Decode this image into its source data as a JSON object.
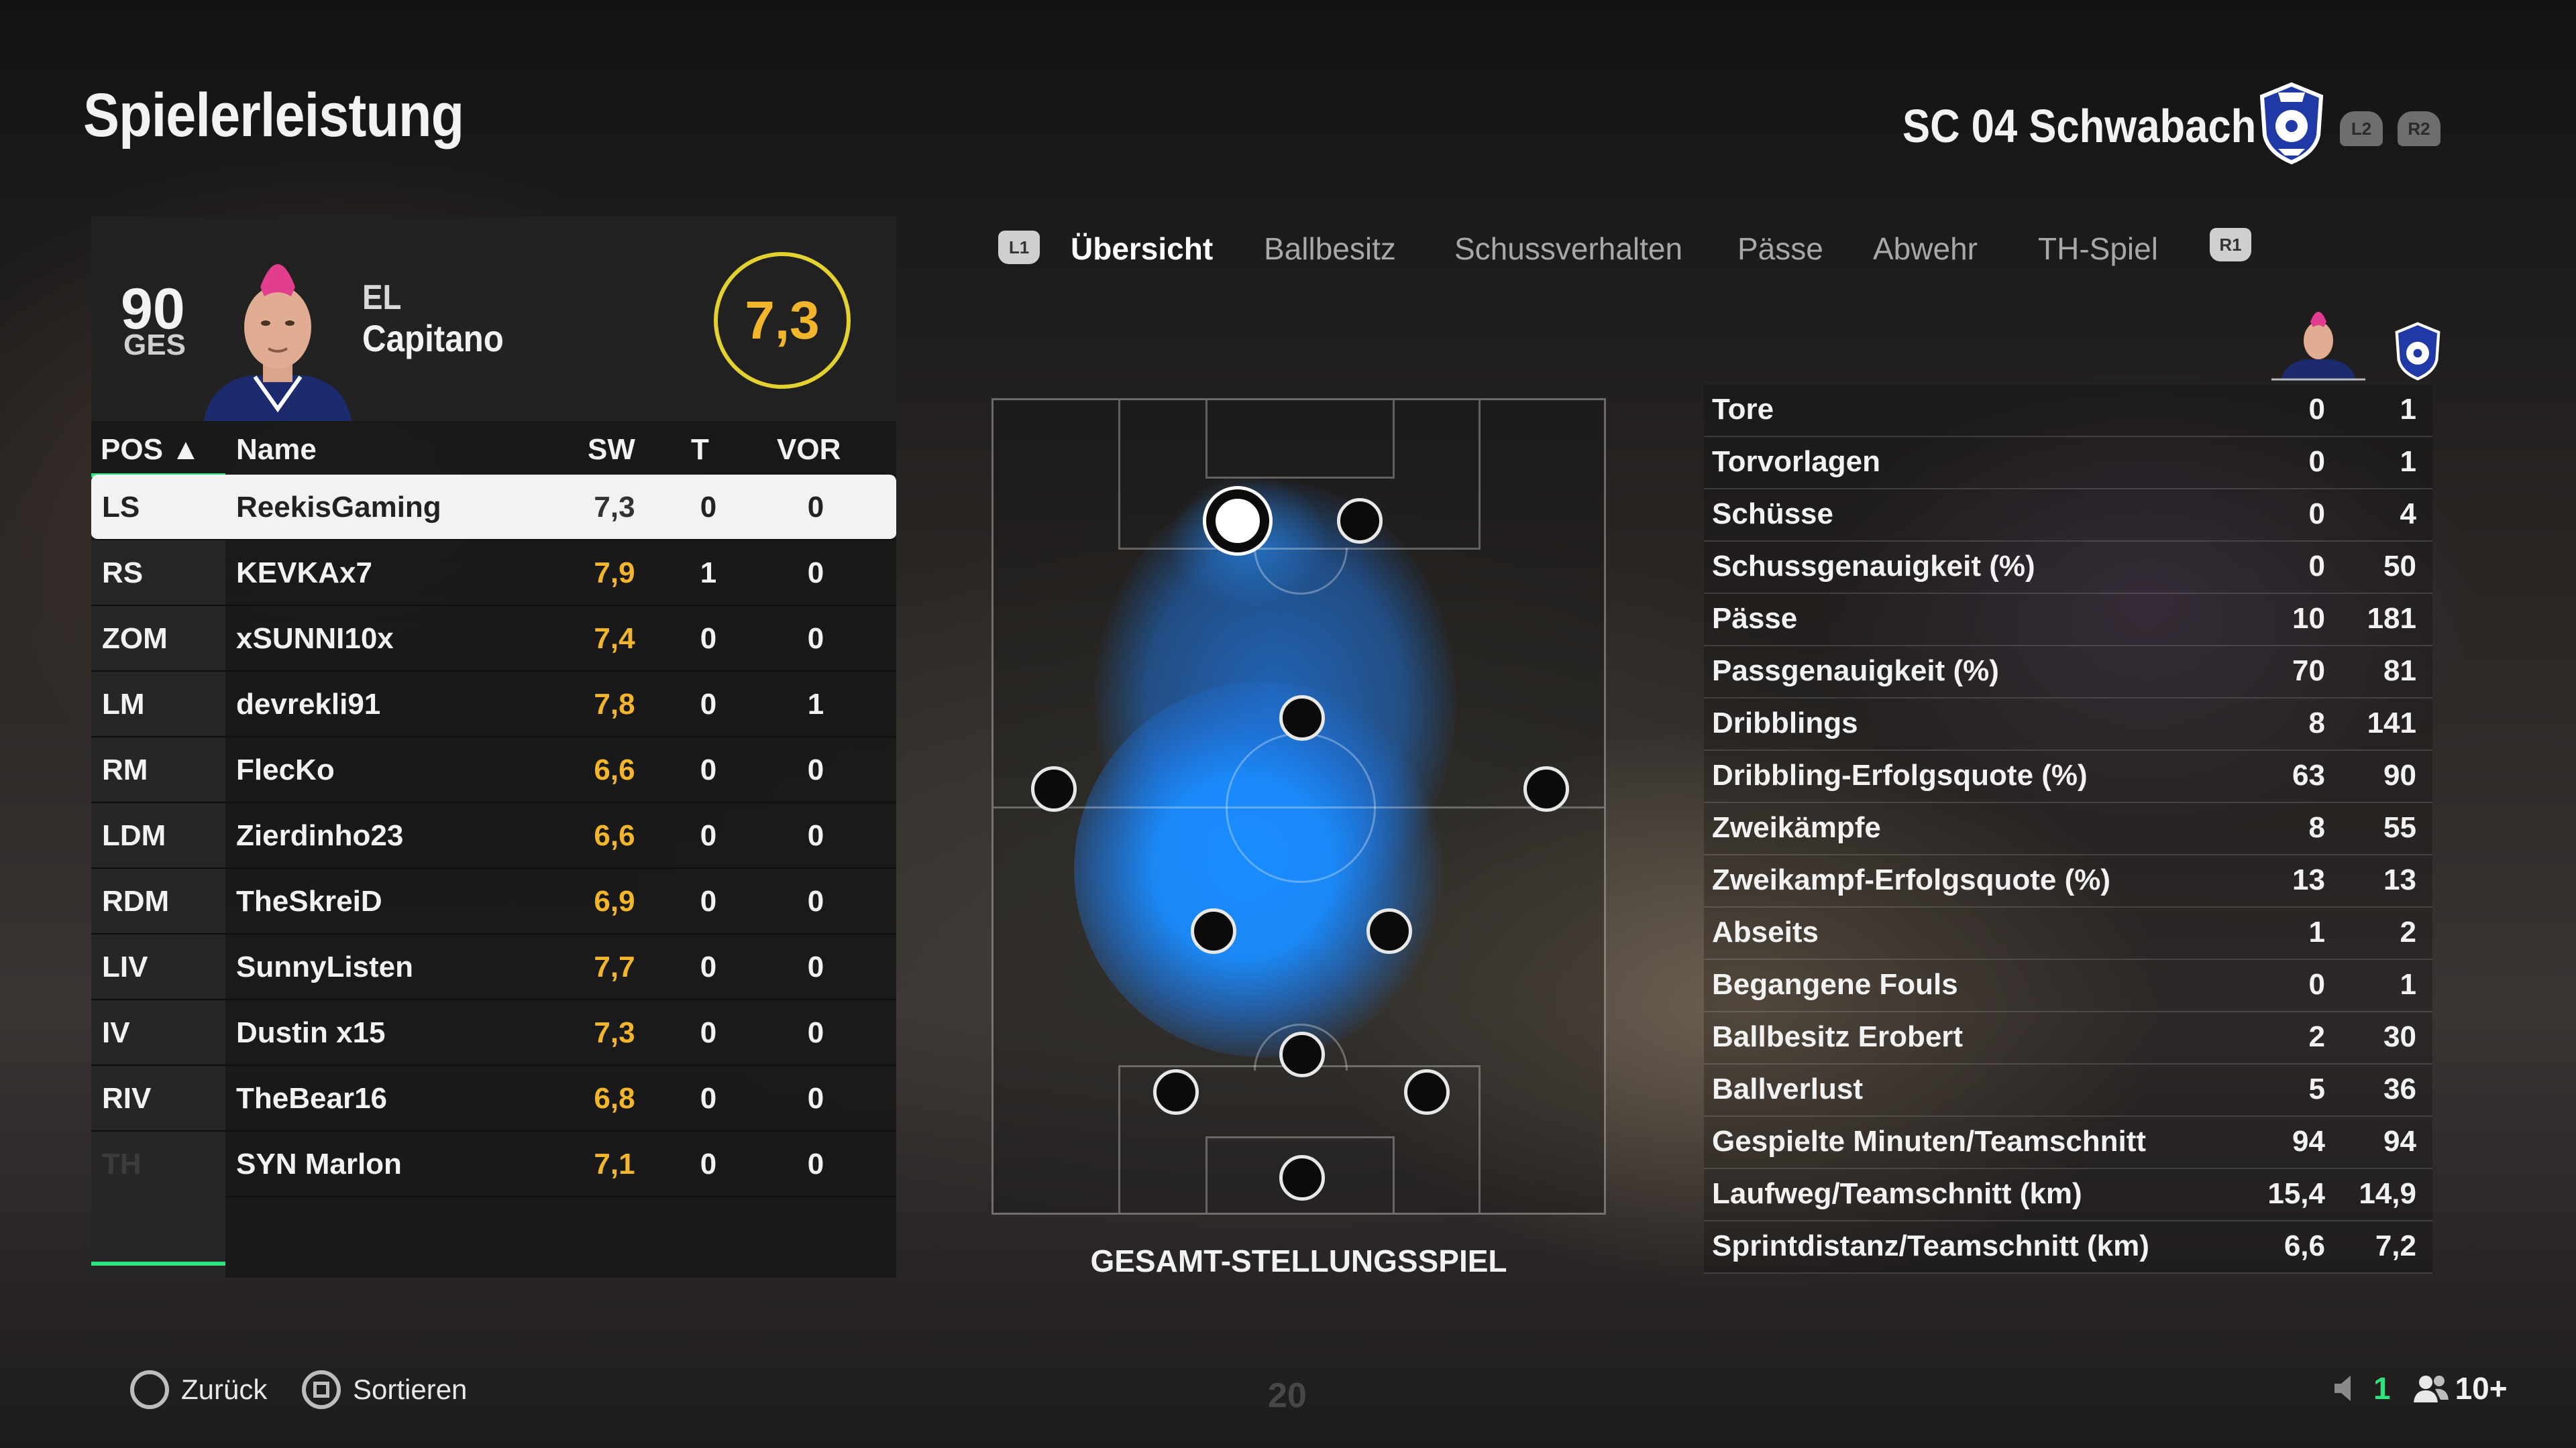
{
  "header": {
    "title": "Spielerleistung",
    "club_name": "SC 04 Schwabach",
    "l2_label": "L2",
    "r2_label": "R2"
  },
  "player_card": {
    "overall": "90",
    "overall_label": "GES",
    "nick_line1": "EL",
    "nick_line2": "Capitano",
    "rating": "7,3"
  },
  "table": {
    "headers": {
      "pos": "POS ▲",
      "name": "Name",
      "sw": "SW",
      "t": "T",
      "vor": "VOR"
    },
    "rows": [
      {
        "pos": "LS",
        "name": "ReekisGaming",
        "sw": "7,3",
        "t": "0",
        "vor": "0"
      },
      {
        "pos": "RS",
        "name": "KEVKAx7",
        "sw": "7,9",
        "t": "1",
        "vor": "0"
      },
      {
        "pos": "ZOM",
        "name": "xSUNNI10x",
        "sw": "7,4",
        "t": "0",
        "vor": "0"
      },
      {
        "pos": "LM",
        "name": "devrekli91",
        "sw": "7,8",
        "t": "0",
        "vor": "1"
      },
      {
        "pos": "RM",
        "name": "FlecKo",
        "sw": "6,6",
        "t": "0",
        "vor": "0"
      },
      {
        "pos": "LDM",
        "name": "Zierdinho23",
        "sw": "6,6",
        "t": "0",
        "vor": "0"
      },
      {
        "pos": "RDM",
        "name": "TheSkreiD",
        "sw": "6,9",
        "t": "0",
        "vor": "0"
      },
      {
        "pos": "LIV",
        "name": "SunnyListen",
        "sw": "7,7",
        "t": "0",
        "vor": "0"
      },
      {
        "pos": "IV",
        "name": "Dustin x15",
        "sw": "7,3",
        "t": "0",
        "vor": "0"
      },
      {
        "pos": "RIV",
        "name": "TheBear16",
        "sw": "6,8",
        "t": "0",
        "vor": "0"
      },
      {
        "pos": "TH",
        "name": "SYN Marlon",
        "sw": "7,1",
        "t": "0",
        "vor": "0"
      }
    ]
  },
  "tabs": {
    "l1_label": "L1",
    "r1_label": "R1",
    "items": [
      "Übersicht",
      "Ballbesitz",
      "Schussverhalten",
      "Pässe",
      "Abwehr",
      "TH-Spiel"
    ]
  },
  "pitch": {
    "caption": "GESAMT-STELLUNGSSPIEL"
  },
  "stats": [
    {
      "label": "Tore",
      "me": "0",
      "team": "1"
    },
    {
      "label": "Torvorlagen",
      "me": "0",
      "team": "1"
    },
    {
      "label": "Schüsse",
      "me": "0",
      "team": "4"
    },
    {
      "label": "Schussgenauigkeit (%)",
      "me": "0",
      "team": "50"
    },
    {
      "label": "Pässe",
      "me": "10",
      "team": "181"
    },
    {
      "label": "Passgenauigkeit (%)",
      "me": "70",
      "team": "81"
    },
    {
      "label": "Dribblings",
      "me": "8",
      "team": "141"
    },
    {
      "label": "Dribbling-Erfolgsquote (%)",
      "me": "63",
      "team": "90"
    },
    {
      "label": "Zweikämpfe",
      "me": "8",
      "team": "55"
    },
    {
      "label": "Zweikampf-Erfolgsquote (%)",
      "me": "13",
      "team": "13"
    },
    {
      "label": "Abseits",
      "me": "1",
      "team": "2"
    },
    {
      "label": "Begangene Fouls",
      "me": "0",
      "team": "1"
    },
    {
      "label": "Ballbesitz Erobert",
      "me": "2",
      "team": "30"
    },
    {
      "label": "Ballverlust",
      "me": "5",
      "team": "36"
    },
    {
      "label": "Gespielte Minuten/Teamschnitt",
      "me": "94",
      "team": "94"
    },
    {
      "label": "Laufweg/Teamschnitt (km)",
      "me": "15,4",
      "team": "14,9"
    },
    {
      "label": "Sprintdistanz/Teamschnitt (km)",
      "me": "6,6",
      "team": "7,2"
    }
  ],
  "footer": {
    "back_label": "Zurück",
    "sort_label": "Sortieren",
    "faint_number": "20",
    "status_count": "1",
    "players_count": "10+"
  },
  "colors": {
    "rating_ring": "#e2d12e",
    "rating_text": "#f3b62a",
    "accent_green": "#2ee47e",
    "heat_blue": "#1a8cff"
  }
}
